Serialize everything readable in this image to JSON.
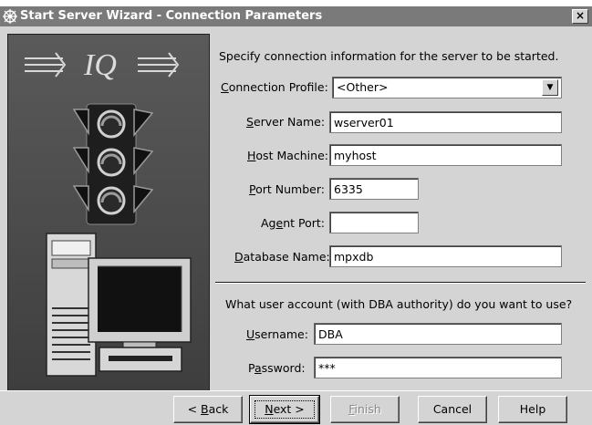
{
  "window": {
    "title": "Start Server Wizard - Connection Parameters",
    "close_glyph": "×"
  },
  "intro_text": "Specify connection information for the server to be started.",
  "connection_profile": {
    "label_pre": "",
    "label_ul": "C",
    "label_post": "onnection Profile:",
    "value": "<Other>"
  },
  "server_name": {
    "label_ul": "S",
    "label_post": "erver Name:",
    "value": "wserver01"
  },
  "host_machine": {
    "label_ul": "H",
    "label_post": "ost Machine:",
    "value": "myhost"
  },
  "port_number": {
    "label_ul": "P",
    "label_post": "ort Number:",
    "value": "6335"
  },
  "agent_port": {
    "label_pre": "Ag",
    "label_ul": "e",
    "label_post": "nt Port:",
    "value": ""
  },
  "database_name": {
    "label_ul": "D",
    "label_post": "atabase Name:",
    "value": "mpxdb"
  },
  "question": "What user account (with DBA authority) do you want to use?",
  "username": {
    "label_ul": "U",
    "label_post": "sername:",
    "value": "DBA"
  },
  "password": {
    "label_pre": "P",
    "label_ul": "a",
    "label_post": "ssword:",
    "value": "***"
  },
  "buttons": {
    "back": {
      "pre": "< ",
      "ul": "B",
      "post": "ack"
    },
    "next": {
      "pre": "",
      "ul": "N",
      "post": "ext >"
    },
    "finish": {
      "pre": "",
      "ul": "F",
      "post": "inish"
    },
    "cancel": "Cancel",
    "help": "Help"
  },
  "logo_text": "IQ"
}
